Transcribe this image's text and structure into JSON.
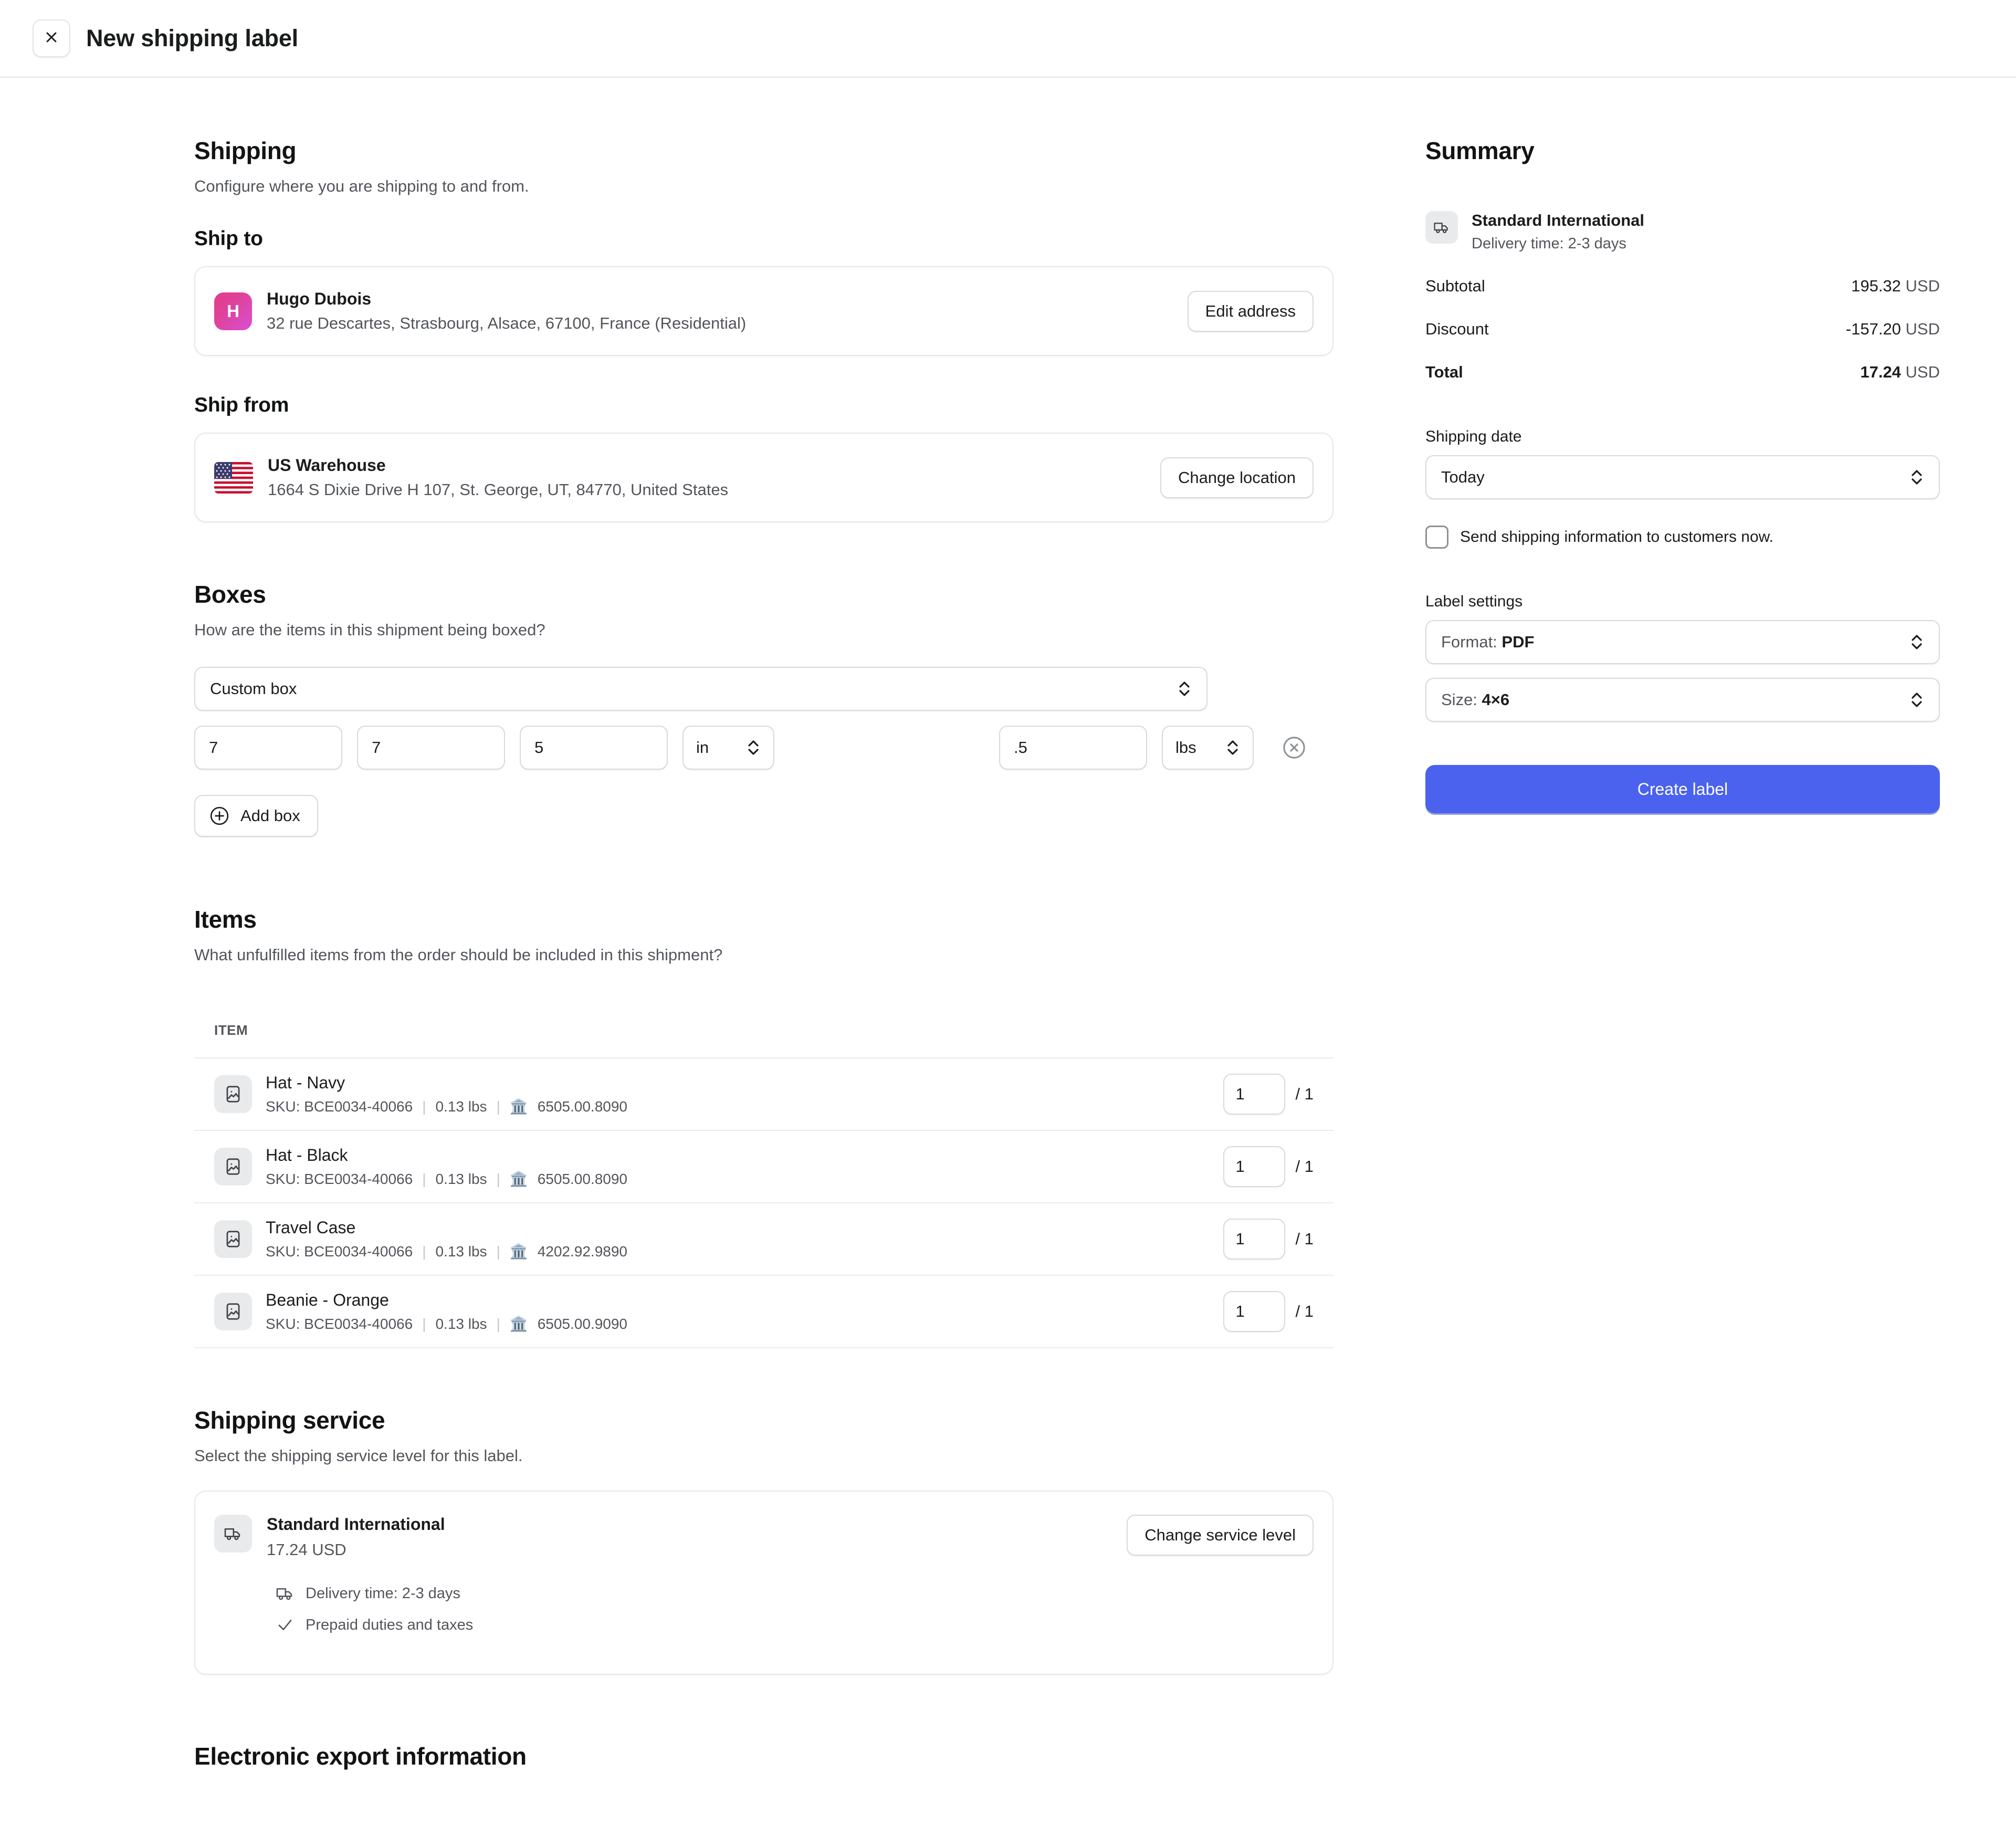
{
  "topbar": {
    "close_icon": "close-icon",
    "title": "New shipping label"
  },
  "shipping": {
    "title": "Shipping",
    "subtitle": "Configure where you are shipping to and from.",
    "ship_to": {
      "heading": "Ship to",
      "avatar_initial": "H",
      "name": "Hugo Dubois",
      "address": "32 rue Descartes, Strasbourg, Alsace, 67100, France (Residential)",
      "button": "Edit address"
    },
    "ship_from": {
      "heading": "Ship from",
      "flag_icon": "us-flag-icon",
      "name": "US Warehouse",
      "address": "1664 S Dixie Drive H 107, St. George, UT, 84770, United States",
      "button": "Change location"
    }
  },
  "boxes": {
    "title": "Boxes",
    "subtitle": "How are the items in this shipment being boxed?",
    "box_type": "Custom box",
    "length": "7",
    "width": "7",
    "height": "5",
    "dimension_unit": "in",
    "weight": ".5",
    "weight_unit": "lbs",
    "remove_icon": "remove-circle-icon",
    "add_box_label": "Add box",
    "add_box_icon": "plus-circle-icon"
  },
  "items": {
    "title": "Items",
    "subtitle": "What unfulfilled items from the order should be included in this shipment?",
    "column_header": "ITEM",
    "sku_prefix": "SKU:",
    "rows": [
      {
        "thumb_icon": "image-placeholder-icon",
        "name": "Hat - Navy",
        "sku": "BCE0034-40066",
        "weight": "0.13 lbs",
        "hs_icon": "hs-code-icon",
        "hs_code": "6505.00.8090",
        "qty": "1",
        "qty_total": "/ 1"
      },
      {
        "thumb_icon": "image-placeholder-icon",
        "name": "Hat - Black",
        "sku": "BCE0034-40066",
        "weight": "0.13 lbs",
        "hs_icon": "hs-code-icon",
        "hs_code": "6505.00.8090",
        "qty": "1",
        "qty_total": "/ 1"
      },
      {
        "thumb_icon": "image-placeholder-icon",
        "name": "Travel Case",
        "sku": "BCE0034-40066",
        "weight": "0.13 lbs",
        "hs_icon": "hs-code-icon",
        "hs_code": "4202.92.9890",
        "qty": "1",
        "qty_total": "/ 1"
      },
      {
        "thumb_icon": "image-placeholder-icon",
        "name": "Beanie - Orange",
        "sku": "BCE0034-40066",
        "weight": "0.13 lbs",
        "hs_icon": "hs-code-icon",
        "hs_code": "6505.00.9090",
        "qty": "1",
        "qty_total": "/ 1"
      }
    ]
  },
  "shipping_service": {
    "title": "Shipping service",
    "subtitle": "Select the shipping service level for this label.",
    "icon": "truck-icon",
    "name": "Standard International",
    "price": "17.24 USD",
    "button": "Change service level",
    "features": [
      {
        "icon": "truck-icon",
        "label": "Delivery time: 2-3 days"
      },
      {
        "icon": "check-icon",
        "label": "Prepaid duties and taxes"
      }
    ]
  },
  "electronic_export": {
    "title": "Electronic export information"
  },
  "summary": {
    "title": "Summary",
    "service_icon": "truck-icon",
    "service_name": "Standard International",
    "service_sub": "Delivery time: 2-3 days",
    "lines": [
      {
        "label": "Subtotal",
        "amount": "195.32",
        "currency": "USD"
      },
      {
        "label": "Discount",
        "amount": "-157.20",
        "currency": "USD"
      },
      {
        "label": "Total",
        "amount": "17.24",
        "currency": "USD"
      }
    ],
    "shipping_date_label": "Shipping date",
    "shipping_date_value": "Today",
    "send_info_checkbox_label": "Send shipping information to customers now.",
    "label_settings_label": "Label settings",
    "format_label": "Format:",
    "format_value": "PDF",
    "size_label": "Size:",
    "size_value": "4×6",
    "create_button": "Create label"
  },
  "colors": {
    "accent": "#4a62ee",
    "avatar_gradient_start": "#e23a8a",
    "avatar_gradient_end": "#d94fd4",
    "border": "#d7d9dc",
    "text_subdued": "#52555a"
  }
}
